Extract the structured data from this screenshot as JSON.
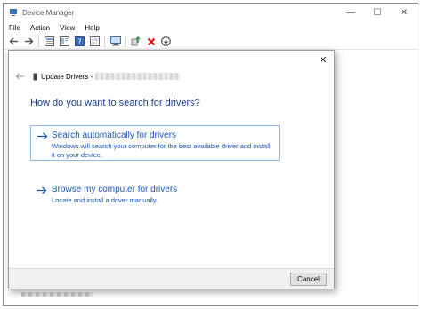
{
  "window": {
    "title": "Device Manager",
    "controls": {
      "minimize": "—",
      "maximize": "☐",
      "close": "✕"
    }
  },
  "menu": [
    "File",
    "Action",
    "View",
    "Help"
  ],
  "toolbar": {
    "icons": [
      "back-icon",
      "forward-icon",
      "properties-icon",
      "console-tree-icon",
      "help-icon",
      "details-icon",
      "monitor-icon",
      "update-driver-icon",
      "uninstall-icon",
      "download-icon"
    ]
  },
  "dialog": {
    "close_glyph": "✕",
    "header_title": "Update Drivers -",
    "question": "How do you want to search for drivers?",
    "options": [
      {
        "title": "Search automatically for drivers",
        "description": "Windows will search your computer for the best available driver and install it on your device."
      },
      {
        "title": "Browse my computer for drivers",
        "description": "Locate and install a driver manually."
      }
    ],
    "cancel_label": "Cancel"
  },
  "colors": {
    "link_blue": "#1c56b8",
    "heading_blue": "#1e3f8a",
    "selection_border": "#8fb8e8"
  }
}
